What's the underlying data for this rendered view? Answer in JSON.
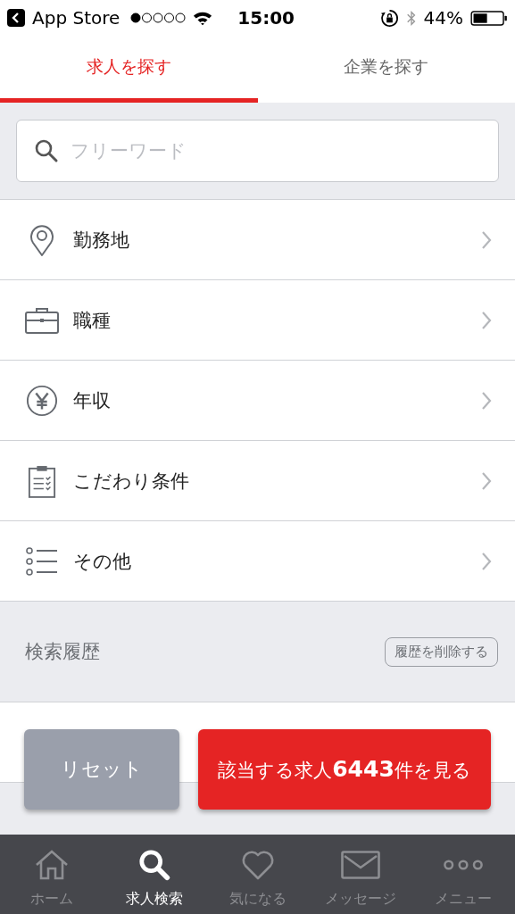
{
  "status_bar": {
    "back_label": "App Store",
    "time": "15:00",
    "battery": "44%"
  },
  "tabs": [
    {
      "label": "求人を探す",
      "selected": true
    },
    {
      "label": "企業を探す",
      "selected": false
    }
  ],
  "search": {
    "placeholder": "フリーワード"
  },
  "menu_items": [
    {
      "kind": "pin",
      "label": "勤務地"
    },
    {
      "kind": "briefcase",
      "label": "職種"
    },
    {
      "kind": "yen",
      "label": "年収"
    },
    {
      "kind": "clipboard",
      "label": "こだわり条件"
    },
    {
      "kind": "list",
      "label": "その他"
    }
  ],
  "history": {
    "title": "検索履歴",
    "clear_button": "履歴を削除する"
  },
  "actions": {
    "reset": "リセット",
    "submit": "該当する求人**6443**件を見る"
  },
  "bottom_nav": [
    {
      "kind": "home",
      "label": "ホーム",
      "selected": false
    },
    {
      "kind": "search",
      "label": "求人検索",
      "selected": true
    },
    {
      "kind": "heart",
      "label": "気になる",
      "selected": false
    },
    {
      "kind": "mail",
      "label": "メッセージ",
      "selected": false
    },
    {
      "kind": "more",
      "label": "メニュー",
      "selected": false
    }
  ]
}
